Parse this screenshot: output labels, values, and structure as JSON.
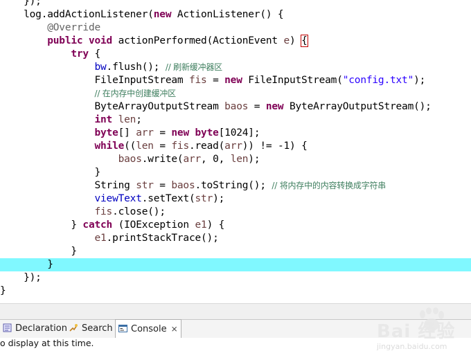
{
  "code_lines": [
    [
      {
        "t": "    });",
        "c": ""
      }
    ],
    [
      {
        "t": "    log.addActionListener(",
        "c": ""
      },
      {
        "t": "new",
        "c": "kw"
      },
      {
        "t": " ActionListener() {",
        "c": ""
      }
    ],
    [
      {
        "t": "        ",
        "c": ""
      },
      {
        "t": "@Override",
        "c": "ann"
      }
    ],
    [
      {
        "t": "        ",
        "c": ""
      },
      {
        "t": "public",
        "c": "kw"
      },
      {
        "t": " ",
        "c": ""
      },
      {
        "t": "void",
        "c": "kw"
      },
      {
        "t": " actionPerformed(ActionEvent ",
        "c": ""
      },
      {
        "t": "e",
        "c": "var"
      },
      {
        "t": ") ",
        "c": ""
      },
      {
        "t": "{",
        "c": "brace"
      }
    ],
    [
      {
        "t": "            ",
        "c": ""
      },
      {
        "t": "try",
        "c": "kw"
      },
      {
        "t": " {",
        "c": ""
      }
    ],
    [
      {
        "t": "                ",
        "c": ""
      },
      {
        "t": "bw",
        "c": "fld"
      },
      {
        "t": ".flush(); ",
        "c": ""
      },
      {
        "t": "// 刷新缓冲器区",
        "c": "cmt"
      }
    ],
    [
      {
        "t": "                FileInputStream ",
        "c": ""
      },
      {
        "t": "fis",
        "c": "var"
      },
      {
        "t": " = ",
        "c": ""
      },
      {
        "t": "new",
        "c": "kw"
      },
      {
        "t": " FileInputStream(",
        "c": ""
      },
      {
        "t": "\"config.txt\"",
        "c": "str"
      },
      {
        "t": ");",
        "c": ""
      }
    ],
    [
      {
        "t": "                ",
        "c": ""
      },
      {
        "t": "// 在内存中创建缓冲区",
        "c": "cmt"
      }
    ],
    [
      {
        "t": "                ByteArrayOutputStream ",
        "c": ""
      },
      {
        "t": "baos",
        "c": "var"
      },
      {
        "t": " = ",
        "c": ""
      },
      {
        "t": "new",
        "c": "kw"
      },
      {
        "t": " ByteArrayOutputStream();",
        "c": ""
      }
    ],
    [
      {
        "t": "                ",
        "c": ""
      },
      {
        "t": "int",
        "c": "kw"
      },
      {
        "t": " ",
        "c": ""
      },
      {
        "t": "len",
        "c": "var"
      },
      {
        "t": ";",
        "c": ""
      }
    ],
    [
      {
        "t": "                ",
        "c": ""
      },
      {
        "t": "byte",
        "c": "kw"
      },
      {
        "t": "[] ",
        "c": ""
      },
      {
        "t": "arr",
        "c": "var"
      },
      {
        "t": " = ",
        "c": ""
      },
      {
        "t": "new",
        "c": "kw"
      },
      {
        "t": " ",
        "c": ""
      },
      {
        "t": "byte",
        "c": "kw"
      },
      {
        "t": "[1024];",
        "c": ""
      }
    ],
    [
      {
        "t": "                ",
        "c": ""
      },
      {
        "t": "while",
        "c": "kw"
      },
      {
        "t": "((",
        "c": ""
      },
      {
        "t": "len",
        "c": "var"
      },
      {
        "t": " = ",
        "c": ""
      },
      {
        "t": "fis",
        "c": "var"
      },
      {
        "t": ".read(",
        "c": ""
      },
      {
        "t": "arr",
        "c": "var"
      },
      {
        "t": ")) != -1) {",
        "c": ""
      }
    ],
    [
      {
        "t": "                    ",
        "c": ""
      },
      {
        "t": "baos",
        "c": "var"
      },
      {
        "t": ".write(",
        "c": ""
      },
      {
        "t": "arr",
        "c": "var"
      },
      {
        "t": ", 0, ",
        "c": ""
      },
      {
        "t": "len",
        "c": "var"
      },
      {
        "t": ");",
        "c": ""
      }
    ],
    [
      {
        "t": "                }",
        "c": ""
      }
    ],
    [
      {
        "t": "                String ",
        "c": ""
      },
      {
        "t": "str",
        "c": "var"
      },
      {
        "t": " = ",
        "c": ""
      },
      {
        "t": "baos",
        "c": "var"
      },
      {
        "t": ".toString(); ",
        "c": ""
      },
      {
        "t": "// 将内存中的内容转换成字符串",
        "c": "cmt"
      }
    ],
    [
      {
        "t": "                ",
        "c": ""
      },
      {
        "t": "viewText",
        "c": "fld"
      },
      {
        "t": ".setText(",
        "c": ""
      },
      {
        "t": "str",
        "c": "var"
      },
      {
        "t": ");",
        "c": ""
      }
    ],
    [
      {
        "t": "                ",
        "c": ""
      },
      {
        "t": "fis",
        "c": "var"
      },
      {
        "t": ".close();",
        "c": ""
      }
    ],
    [
      {
        "t": "            } ",
        "c": ""
      },
      {
        "t": "catch",
        "c": "kw"
      },
      {
        "t": " (IOException ",
        "c": ""
      },
      {
        "t": "e1",
        "c": "var"
      },
      {
        "t": ") {",
        "c": ""
      }
    ],
    [
      {
        "t": "                ",
        "c": ""
      },
      {
        "t": "e1",
        "c": "var"
      },
      {
        "t": ".printStackTrace();",
        "c": ""
      }
    ],
    [
      {
        "t": "            }",
        "c": ""
      }
    ],
    [
      {
        "t": "        }",
        "c": ""
      }
    ],
    [
      {
        "t": "    });",
        "c": ""
      }
    ],
    [
      {
        "t": "}",
        "c": ""
      }
    ]
  ],
  "highlighted_line_index": 20,
  "tabs": [
    {
      "name": "tab-declaration",
      "icon": "declaration-icon",
      "label": "Declaration",
      "active": false
    },
    {
      "name": "tab-search",
      "icon": "search-icon",
      "label": "Search",
      "active": false
    },
    {
      "name": "tab-console",
      "icon": "console-icon",
      "label": "Console",
      "active": true,
      "close": "⨯"
    }
  ],
  "console": {
    "message": "o display at this time."
  },
  "watermark": {
    "text": "Bai 经验",
    "url": "jingyan.baidu.com"
  },
  "colors": {
    "keyword": "#7f0055",
    "annotation": "#646464",
    "field": "#0000c0",
    "local_var": "#6a3e3e",
    "string": "#2a00ff",
    "comment": "#3f7f5f",
    "current_line": "#80f8ff"
  }
}
